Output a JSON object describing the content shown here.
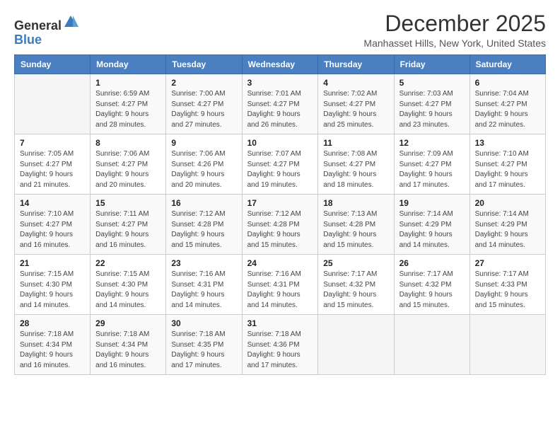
{
  "header": {
    "logo_general": "General",
    "logo_blue": "Blue",
    "title": "December 2025",
    "subtitle": "Manhasset Hills, New York, United States"
  },
  "days_of_week": [
    "Sunday",
    "Monday",
    "Tuesday",
    "Wednesday",
    "Thursday",
    "Friday",
    "Saturday"
  ],
  "weeks": [
    [
      {
        "day": "",
        "info": ""
      },
      {
        "day": "1",
        "info": "Sunrise: 6:59 AM\nSunset: 4:27 PM\nDaylight: 9 hours\nand 28 minutes."
      },
      {
        "day": "2",
        "info": "Sunrise: 7:00 AM\nSunset: 4:27 PM\nDaylight: 9 hours\nand 27 minutes."
      },
      {
        "day": "3",
        "info": "Sunrise: 7:01 AM\nSunset: 4:27 PM\nDaylight: 9 hours\nand 26 minutes."
      },
      {
        "day": "4",
        "info": "Sunrise: 7:02 AM\nSunset: 4:27 PM\nDaylight: 9 hours\nand 25 minutes."
      },
      {
        "day": "5",
        "info": "Sunrise: 7:03 AM\nSunset: 4:27 PM\nDaylight: 9 hours\nand 23 minutes."
      },
      {
        "day": "6",
        "info": "Sunrise: 7:04 AM\nSunset: 4:27 PM\nDaylight: 9 hours\nand 22 minutes."
      }
    ],
    [
      {
        "day": "7",
        "info": "Sunrise: 7:05 AM\nSunset: 4:27 PM\nDaylight: 9 hours\nand 21 minutes."
      },
      {
        "day": "8",
        "info": "Sunrise: 7:06 AM\nSunset: 4:27 PM\nDaylight: 9 hours\nand 20 minutes."
      },
      {
        "day": "9",
        "info": "Sunrise: 7:06 AM\nSunset: 4:26 PM\nDaylight: 9 hours\nand 20 minutes."
      },
      {
        "day": "10",
        "info": "Sunrise: 7:07 AM\nSunset: 4:27 PM\nDaylight: 9 hours\nand 19 minutes."
      },
      {
        "day": "11",
        "info": "Sunrise: 7:08 AM\nSunset: 4:27 PM\nDaylight: 9 hours\nand 18 minutes."
      },
      {
        "day": "12",
        "info": "Sunrise: 7:09 AM\nSunset: 4:27 PM\nDaylight: 9 hours\nand 17 minutes."
      },
      {
        "day": "13",
        "info": "Sunrise: 7:10 AM\nSunset: 4:27 PM\nDaylight: 9 hours\nand 17 minutes."
      }
    ],
    [
      {
        "day": "14",
        "info": "Sunrise: 7:10 AM\nSunset: 4:27 PM\nDaylight: 9 hours\nand 16 minutes."
      },
      {
        "day": "15",
        "info": "Sunrise: 7:11 AM\nSunset: 4:27 PM\nDaylight: 9 hours\nand 16 minutes."
      },
      {
        "day": "16",
        "info": "Sunrise: 7:12 AM\nSunset: 4:28 PM\nDaylight: 9 hours\nand 15 minutes."
      },
      {
        "day": "17",
        "info": "Sunrise: 7:12 AM\nSunset: 4:28 PM\nDaylight: 9 hours\nand 15 minutes."
      },
      {
        "day": "18",
        "info": "Sunrise: 7:13 AM\nSunset: 4:28 PM\nDaylight: 9 hours\nand 15 minutes."
      },
      {
        "day": "19",
        "info": "Sunrise: 7:14 AM\nSunset: 4:29 PM\nDaylight: 9 hours\nand 14 minutes."
      },
      {
        "day": "20",
        "info": "Sunrise: 7:14 AM\nSunset: 4:29 PM\nDaylight: 9 hours\nand 14 minutes."
      }
    ],
    [
      {
        "day": "21",
        "info": "Sunrise: 7:15 AM\nSunset: 4:30 PM\nDaylight: 9 hours\nand 14 minutes."
      },
      {
        "day": "22",
        "info": "Sunrise: 7:15 AM\nSunset: 4:30 PM\nDaylight: 9 hours\nand 14 minutes."
      },
      {
        "day": "23",
        "info": "Sunrise: 7:16 AM\nSunset: 4:31 PM\nDaylight: 9 hours\nand 14 minutes."
      },
      {
        "day": "24",
        "info": "Sunrise: 7:16 AM\nSunset: 4:31 PM\nDaylight: 9 hours\nand 14 minutes."
      },
      {
        "day": "25",
        "info": "Sunrise: 7:17 AM\nSunset: 4:32 PM\nDaylight: 9 hours\nand 15 minutes."
      },
      {
        "day": "26",
        "info": "Sunrise: 7:17 AM\nSunset: 4:32 PM\nDaylight: 9 hours\nand 15 minutes."
      },
      {
        "day": "27",
        "info": "Sunrise: 7:17 AM\nSunset: 4:33 PM\nDaylight: 9 hours\nand 15 minutes."
      }
    ],
    [
      {
        "day": "28",
        "info": "Sunrise: 7:18 AM\nSunset: 4:34 PM\nDaylight: 9 hours\nand 16 minutes."
      },
      {
        "day": "29",
        "info": "Sunrise: 7:18 AM\nSunset: 4:34 PM\nDaylight: 9 hours\nand 16 minutes."
      },
      {
        "day": "30",
        "info": "Sunrise: 7:18 AM\nSunset: 4:35 PM\nDaylight: 9 hours\nand 17 minutes."
      },
      {
        "day": "31",
        "info": "Sunrise: 7:18 AM\nSunset: 4:36 PM\nDaylight: 9 hours\nand 17 minutes."
      },
      {
        "day": "",
        "info": ""
      },
      {
        "day": "",
        "info": ""
      },
      {
        "day": "",
        "info": ""
      }
    ]
  ]
}
